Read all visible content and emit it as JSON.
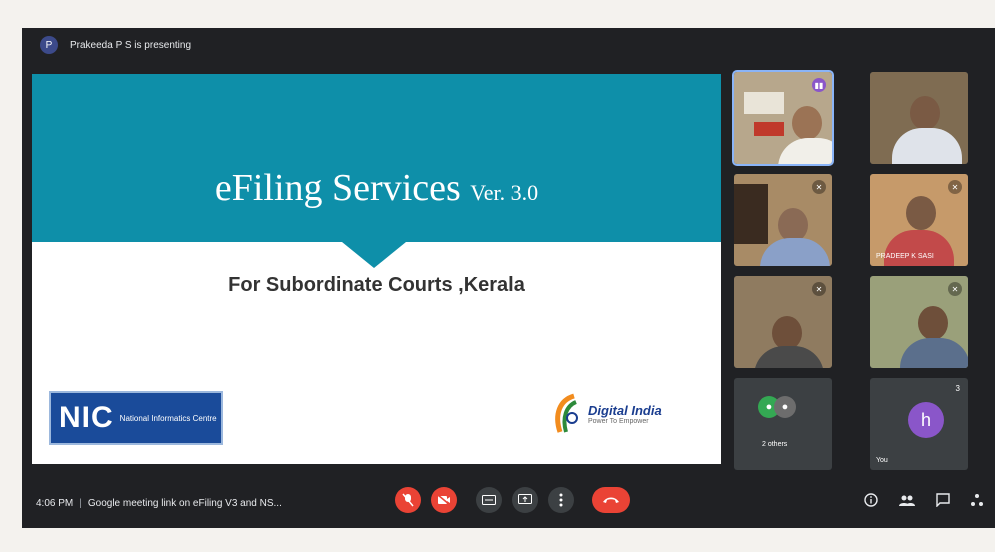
{
  "topbar": {
    "presenter_initial": "P",
    "presenting_text": "Prakeeda P S is presenting"
  },
  "slide": {
    "title": "eFiling Services",
    "version": "Ver. 3.0",
    "subtitle": "For Subordinate Courts ,Kerala",
    "nic_logo": "NIC",
    "nic_text": "National Informatics Centre",
    "digital_india": "Digital India",
    "digital_india_tag": "Power To Empower"
  },
  "tiles": [
    {
      "name": ""
    },
    {
      "name": ""
    },
    {
      "name": ""
    },
    {
      "name": "PRADEEP K SASI"
    },
    {
      "name": ""
    },
    {
      "name": ""
    },
    {
      "name": "2 others"
    },
    {
      "name": "You",
      "initial": "h",
      "count": "3"
    }
  ],
  "bottombar": {
    "time": "4:06 PM",
    "meeting_title": "Google meeting link on eFiling V3 and NS..."
  },
  "colors": {
    "slide_band": "#0e8fa9",
    "red": "#ea4335",
    "meet_bg": "#202124",
    "avatar_purple": "#8a56c9"
  }
}
